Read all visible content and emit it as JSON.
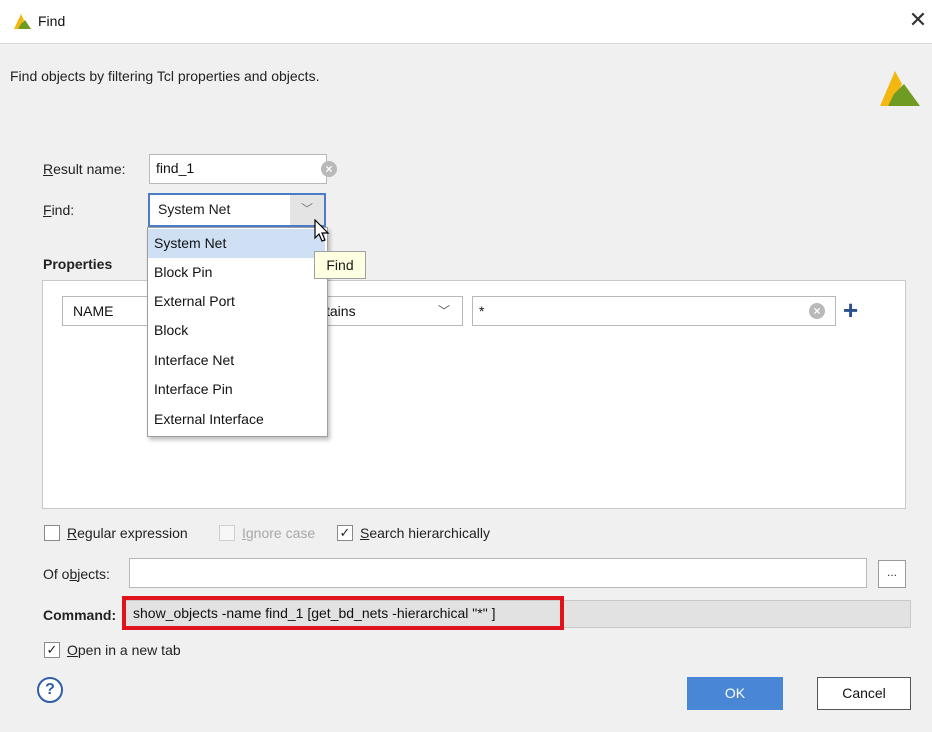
{
  "window": {
    "title": "Find",
    "subtitle": "Find objects by filtering Tcl properties and objects."
  },
  "result_name": {
    "label": "Result name:",
    "value": "find_1"
  },
  "find": {
    "label": "Find:",
    "selected": "System Net",
    "options": [
      "System Net",
      "Block Pin",
      "External Port",
      "Block",
      "Interface Net",
      "Interface Pin",
      "External Interface"
    ],
    "tooltip": "Find"
  },
  "properties": {
    "title": "Properties",
    "row": {
      "property": "NAME",
      "operator_partial": "tains",
      "value": "*"
    }
  },
  "options": {
    "regular_expression": {
      "label": "Regular expression",
      "checked": false
    },
    "ignore_case": {
      "label": "Ignore case",
      "checked": false,
      "disabled": true
    },
    "search_hierarchically": {
      "label": "Search hierarchically",
      "checked": true
    }
  },
  "of_objects": {
    "label": "Of objects:",
    "value": "",
    "more_label": "..."
  },
  "command": {
    "label": "Command:",
    "value": "show_objects -name find_1 [get_bd_nets -hierarchical \"*\" ]"
  },
  "open_new_tab": {
    "label": "Open in a new tab",
    "checked": true
  },
  "buttons": {
    "ok": "OK",
    "cancel": "Cancel",
    "help": "?"
  },
  "icons": {
    "app": "vivado-logo-icon",
    "close": "close-icon",
    "add": "plus-icon",
    "clear": "clear-icon"
  },
  "colors": {
    "accent": "#4a86d6",
    "highlight_border": "#e0131c",
    "logo_yellow": "#f2b711",
    "logo_green": "#6f9b22"
  }
}
